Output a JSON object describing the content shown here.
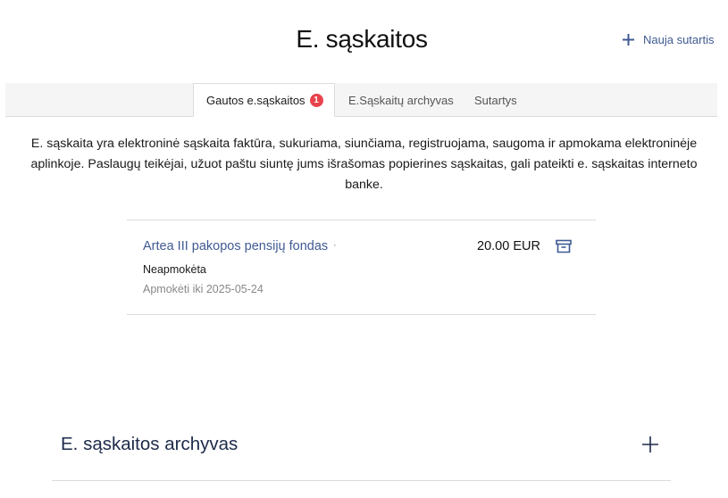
{
  "header": {
    "title": "E. sąskaitos",
    "new_contract_label": "Nauja sutartis"
  },
  "tabs": [
    {
      "label": "Gautos e.sąskaitos",
      "badge": "1",
      "active": true
    },
    {
      "label": "E.Sąskaitų archyvas",
      "active": false
    },
    {
      "label": "Sutartys",
      "active": false
    }
  ],
  "intro": {
    "text": "E. sąskaita yra elektroninė sąskaita faktūra, sukuriama, siunčiama, registruojama, saugoma ir apmokama elektroninėje aplinkoje. Paslaugų teikėjai, užuot paštu siuntę jums išrašomas popierines sąskaitas, gali pateikti e. sąskaitas interneto banke."
  },
  "invoices": [
    {
      "provider": "Artea III pakopos pensijų fondas",
      "separator": "·",
      "amount": "20.00 EUR",
      "status": "Neapmokėta",
      "due": "Apmokėti iki 2025-05-24",
      "archive_icon": "archive-box-icon"
    }
  ],
  "archive_section": {
    "title": "E. sąskaitos archyvas",
    "expand_icon": "plus-icon"
  },
  "colors": {
    "accent": "#3f5a93",
    "badge": "#e8434d",
    "tabbar_bg": "#f5f5f5",
    "divider": "#dcdcdc",
    "muted_text": "#888888"
  }
}
